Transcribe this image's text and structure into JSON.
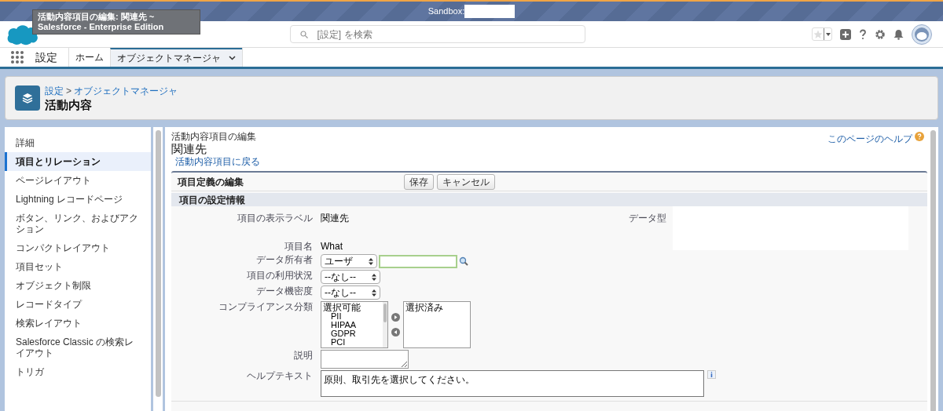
{
  "tooltip": "活動内容項目の編集: 関連先 ~ Salesforce - Enterprise Edition",
  "banner": {
    "sandbox_label": "Sandbox:"
  },
  "search": {
    "placeholder": "[設定] を検索"
  },
  "nav": {
    "app_name": "設定",
    "tabs": [
      {
        "label": "ホーム",
        "selected": false,
        "has_menu": false
      },
      {
        "label": "オブジェクトマネージャ",
        "selected": true,
        "has_menu": true
      }
    ]
  },
  "page_header": {
    "breadcrumb": [
      "設定",
      "オブジェクトマネージャ"
    ],
    "separator": ">",
    "title": "活動内容"
  },
  "sidebar": {
    "items": [
      {
        "label": "詳細",
        "selected": false
      },
      {
        "label": "項目とリレーション",
        "selected": true
      },
      {
        "label": "ページレイアウト",
        "selected": false
      },
      {
        "label": "Lightning レコードページ",
        "selected": false
      },
      {
        "label": "ボタン、リンク、およびアクション",
        "selected": false
      },
      {
        "label": "コンパクトレイアウト",
        "selected": false
      },
      {
        "label": "項目セット",
        "selected": false
      },
      {
        "label": "オブジェクト制限",
        "selected": false
      },
      {
        "label": "レコードタイプ",
        "selected": false
      },
      {
        "label": "検索レイアウト",
        "selected": false
      },
      {
        "label": "Salesforce Classic の検索レイアウト",
        "selected": false
      },
      {
        "label": "トリガ",
        "selected": false
      }
    ]
  },
  "main": {
    "subtitle": "活動内容項目の編集",
    "title": "関連先",
    "back_link": "活動内容項目に戻る",
    "help_link": "このページのヘルプ",
    "section_title": "項目定義の編集",
    "buttons": [
      "保存",
      "キャンセル"
    ],
    "subsection_title": "項目の設定情報",
    "label_field": {
      "label": "項目の表示ラベル",
      "value": "関連先"
    },
    "data_type_label": "データ型",
    "fields": [
      {
        "kind": "text",
        "label": "項目名",
        "value": "What"
      },
      {
        "kind": "lookup",
        "label": "データ所有者",
        "value": "ユーザ"
      },
      {
        "kind": "select",
        "label": "項目の利用状況",
        "value": "--なし--"
      },
      {
        "kind": "select",
        "label": "データ機密度",
        "value": "--なし--"
      },
      {
        "kind": "duallist",
        "label": "コンプライアンス分類",
        "available_header": "選択可能",
        "available": [
          "PII",
          "HIPAA",
          "GDPR",
          "PCI"
        ],
        "selected_header": "選択済み"
      },
      {
        "kind": "textarea",
        "label": "説明"
      },
      {
        "kind": "helptext",
        "label": "ヘルプテキスト",
        "value": "原則、取引先を選択してください。"
      }
    ]
  }
}
